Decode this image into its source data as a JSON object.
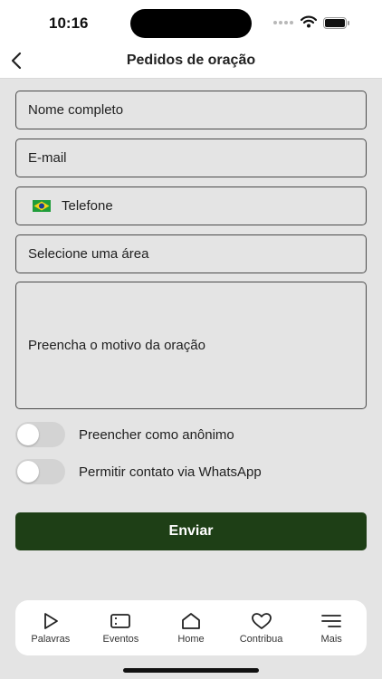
{
  "status_bar": {
    "time": "10:16"
  },
  "header": {
    "title": "Pedidos de oração"
  },
  "form": {
    "name_placeholder": "Nome completo",
    "email_placeholder": "E-mail",
    "phone_placeholder": "Telefone",
    "phone_country": "brazil-flag-icon",
    "area_placeholder": "Selecione uma área",
    "reason_placeholder": "Preencha o motivo da oração",
    "anonymous_label": "Preencher como anônimo",
    "whatsapp_label": "Permitir contato via WhatsApp",
    "anonymous_on": false,
    "whatsapp_on": false,
    "submit_label": "Enviar"
  },
  "tabs": [
    {
      "label": "Palavras",
      "icon": "play-icon"
    },
    {
      "label": "Eventos",
      "icon": "ticket-icon"
    },
    {
      "label": "Home",
      "icon": "home-icon"
    },
    {
      "label": "Contribua",
      "icon": "heart-icon"
    },
    {
      "label": "Mais",
      "icon": "menu-icon"
    }
  ],
  "colors": {
    "accent": "#1e3f16",
    "background": "#e4e4e4"
  }
}
